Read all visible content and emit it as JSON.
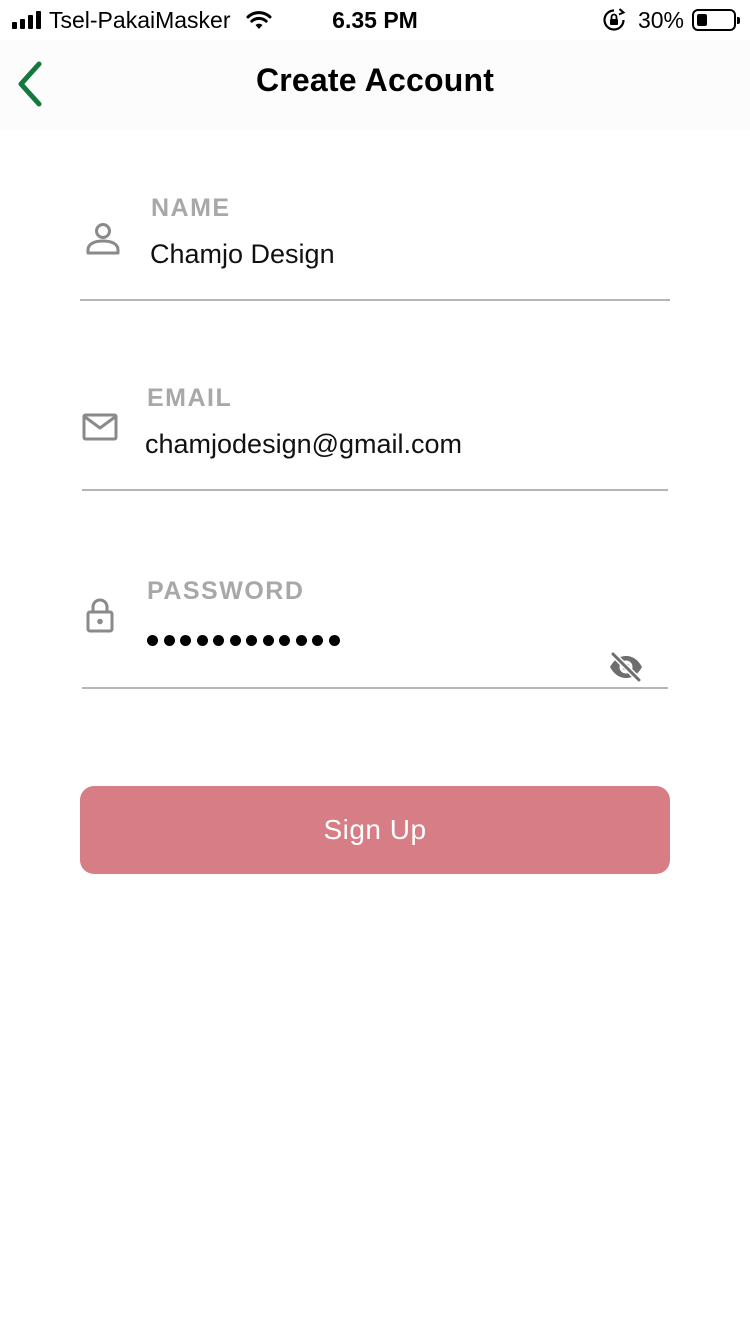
{
  "status_bar": {
    "carrier": "Tsel-PakaiMasker",
    "time": "6.35 PM",
    "battery_percent": "30%",
    "battery_level": 0.3,
    "icons": [
      "signal-icon",
      "wifi-icon",
      "rotation-lock-icon",
      "battery-icon"
    ]
  },
  "nav": {
    "title": "Create Account",
    "back_icon": "chevron-left-icon",
    "accent_color": "#137a3b"
  },
  "form": {
    "name": {
      "label": "NAME",
      "value": "Chamjo Design",
      "icon": "person-icon"
    },
    "email": {
      "label": "EMAIL",
      "value": "chamjodesign@gmail.com",
      "icon": "mail-icon"
    },
    "password": {
      "label": "PASSWORD",
      "masked_length": 12,
      "icon": "lock-icon",
      "toggle_icon": "eye-off-icon"
    }
  },
  "signup_button": {
    "label": "Sign Up",
    "color": "#d67d86"
  }
}
